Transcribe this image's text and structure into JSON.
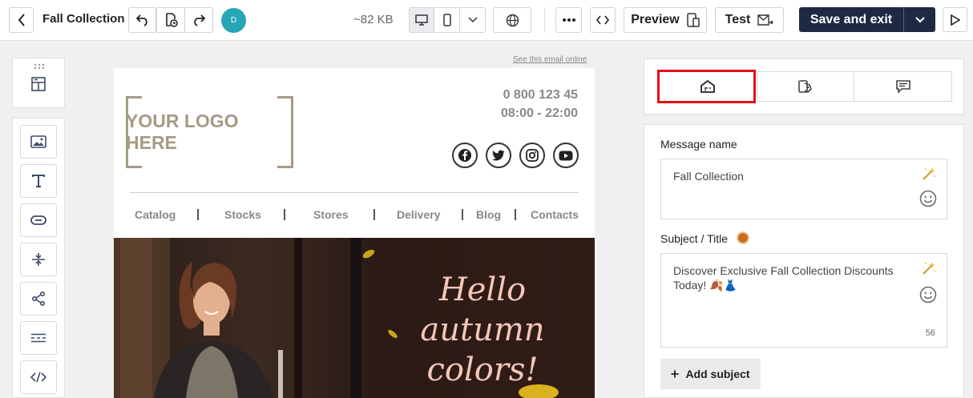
{
  "header": {
    "title": "Fall Collection",
    "avatar_initial": "D",
    "size": "~82 KB",
    "preview_label": "Preview",
    "test_label": "Test",
    "save_label": "Save and exit"
  },
  "email": {
    "see_online": "See this email online",
    "logo_text": "YOUR LOGO HERE",
    "phone": "0 800 123 45",
    "hours": "08:00 - 22:00",
    "social": [
      "facebook-icon",
      "twitter-icon",
      "instagram-icon",
      "youtube-icon"
    ],
    "menu": [
      "Catalog",
      "Stocks",
      "Stores",
      "Delivery",
      "Blog",
      "Contacts"
    ],
    "hero_line1": "Hello",
    "hero_line2": "autumn",
    "hero_line3": "colors!"
  },
  "settings": {
    "tabs": [
      "email-settings-icon",
      "tags-icon",
      "comments-icon"
    ],
    "message_name_label": "Message name",
    "message_name_value": "Fall Collection",
    "subject_label": "Subject / Title",
    "subject_value": "Discover Exclusive Fall Collection Discounts Today! 🍂👗",
    "subject_counter": "56",
    "add_subject_label": "Add subject"
  },
  "colors": {
    "accent_dark": "#1e2a44",
    "avatar": "#26a6b7",
    "highlight": "#e3101a"
  }
}
